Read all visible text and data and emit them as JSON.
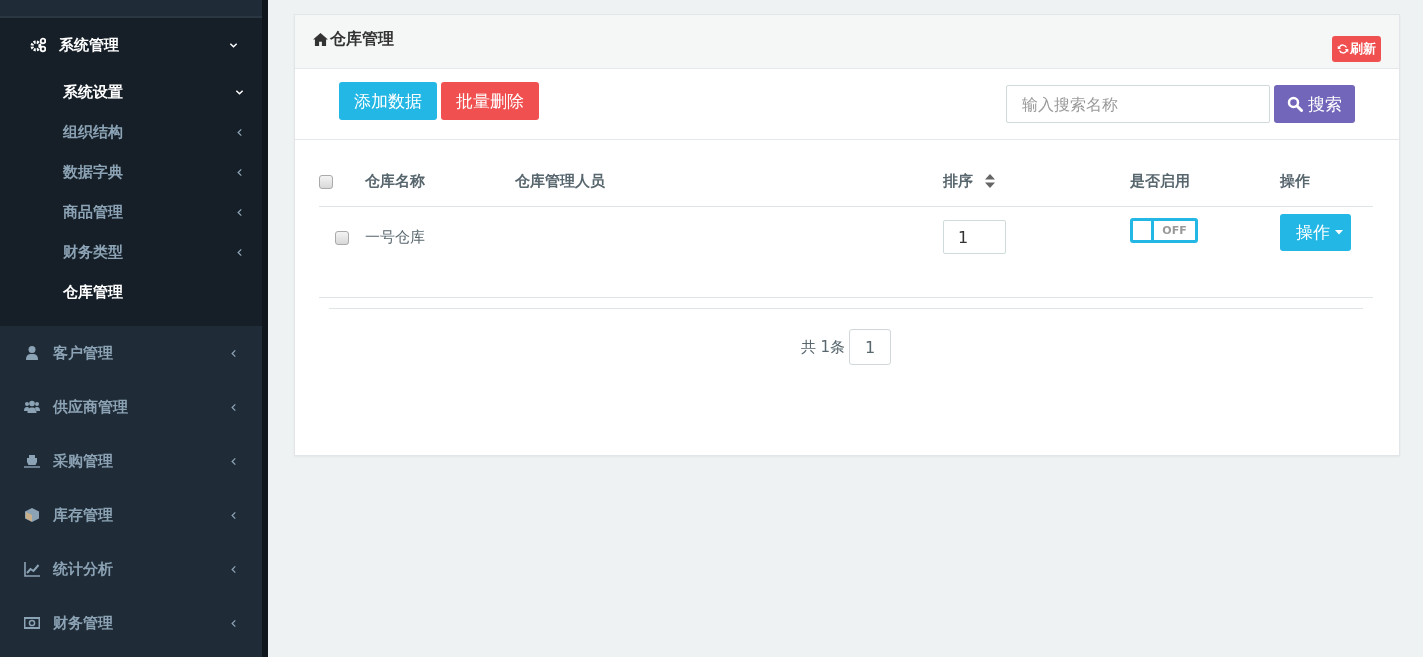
{
  "sidebar": {
    "items": [
      {
        "label": "系统管理",
        "expanded": true,
        "children": [
          {
            "label": "系统设置",
            "kind": "group",
            "expanded": true,
            "selected": true
          },
          {
            "label": "组织结构",
            "kind": "group",
            "expanded": false,
            "selected": false
          },
          {
            "label": "数据字典",
            "kind": "group",
            "expanded": false,
            "selected": false
          },
          {
            "label": "商品管理",
            "kind": "group",
            "expanded": false,
            "selected": false
          },
          {
            "label": "财务类型",
            "kind": "group",
            "expanded": false,
            "selected": false
          },
          {
            "label": "仓库管理",
            "kind": "leaf",
            "selected": true
          }
        ]
      },
      {
        "label": "客户管理",
        "expanded": false
      },
      {
        "label": "供应商管理",
        "expanded": false
      },
      {
        "label": "采购管理",
        "expanded": false
      },
      {
        "label": "库存管理",
        "expanded": false
      },
      {
        "label": "统计分析",
        "expanded": false
      },
      {
        "label": "财务管理",
        "expanded": false
      }
    ]
  },
  "panel": {
    "title": "仓库管理",
    "refresh": "刷新",
    "toolbar": {
      "add": "添加数据",
      "delete": "批量删除",
      "search": {
        "placeholder": "输入搜索名称"
      },
      "search_button": "搜索"
    },
    "table": {
      "select_all": {
        "checked": false
      },
      "columns": [
        {
          "label": "仓库名称",
          "kind": "text"
        },
        {
          "label": "仓库管理人员",
          "kind": "text"
        },
        {
          "label": "排序",
          "kind": "sort"
        },
        {
          "label": "是否启用",
          "kind": "text"
        },
        {
          "label": "操作",
          "kind": "text"
        }
      ],
      "rows": [
        {
          "checked": false,
          "name": "一号仓库",
          "order": "1",
          "enabled": false,
          "switch_label": "OFF",
          "action": "操作"
        }
      ]
    },
    "pagination": {
      "total": "共 1条",
      "pages": [
        {
          "label": "1",
          "selected": false
        }
      ]
    }
  }
}
